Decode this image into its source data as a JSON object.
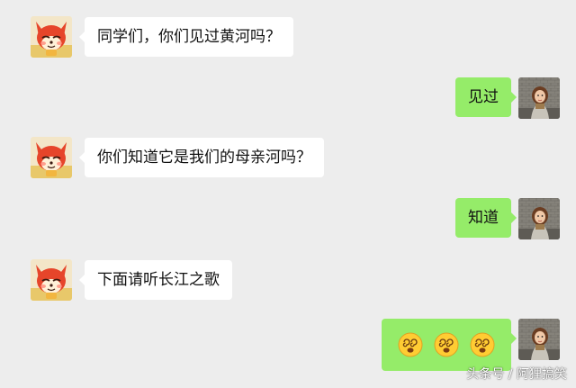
{
  "colors": {
    "background": "#ededed",
    "incoming_bubble": "#ffffff",
    "outgoing_bubble": "#95ec69"
  },
  "messages": [
    {
      "side": "left",
      "avatar": "fox-cartoon-avatar",
      "text": "同学们，你们见过黄河吗？"
    },
    {
      "side": "right",
      "avatar": "girl-photo-avatar",
      "text": "见过"
    },
    {
      "side": "left",
      "avatar": "fox-cartoon-avatar",
      "text": "你们知道它是我们的母亲河吗？"
    },
    {
      "side": "right",
      "avatar": "girl-photo-avatar",
      "text": "知道"
    },
    {
      "side": "left",
      "avatar": "fox-cartoon-avatar",
      "text": "下面请听长江之歌"
    },
    {
      "side": "right",
      "avatar": "girl-photo-avatar",
      "emoji": [
        "dizzy-face-emoji",
        "dizzy-face-emoji",
        "dizzy-face-emoji"
      ]
    }
  ],
  "watermark": "头条号 / 阿狸搞笑"
}
